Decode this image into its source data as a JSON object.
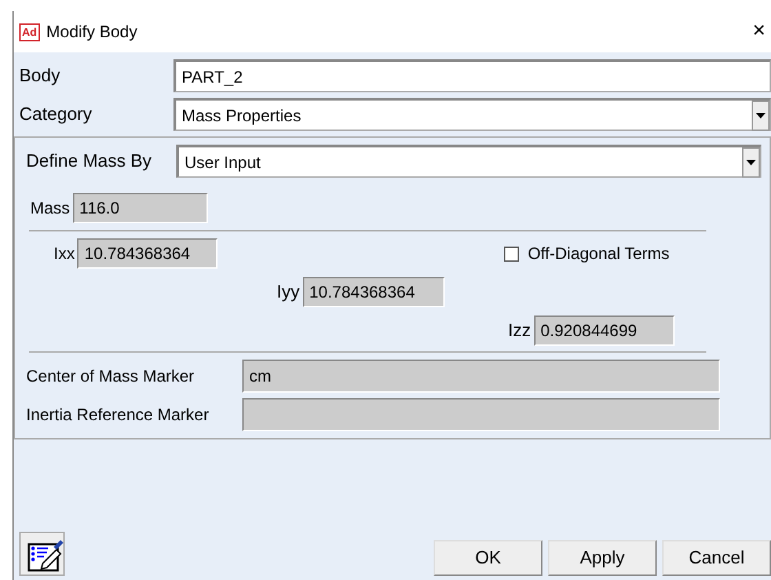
{
  "window": {
    "app_badge": "Ad",
    "title": "Modify Body",
    "close": "×"
  },
  "body": {
    "label": "Body",
    "value": "PART_2"
  },
  "category": {
    "label": "Category",
    "value": "Mass Properties"
  },
  "define_mass_by": {
    "label": "Define Mass By",
    "value": "User Input"
  },
  "mass": {
    "label": "Mass",
    "value": "116.0"
  },
  "ixx": {
    "label": "Ixx",
    "value": "10.784368364"
  },
  "off_diagonal_terms": {
    "label": "Off-Diagonal Terms",
    "checked": false
  },
  "iyy": {
    "label": "Iyy",
    "value": "10.784368364"
  },
  "izz": {
    "label": "Izz",
    "value": "0.920844699"
  },
  "center_of_mass_marker": {
    "label": "Center of Mass Marker",
    "value": "cm"
  },
  "inertia_reference_marker": {
    "label": "Inertia Reference Marker"
  },
  "buttons": [
    "OK",
    "Apply",
    "Cancel"
  ]
}
